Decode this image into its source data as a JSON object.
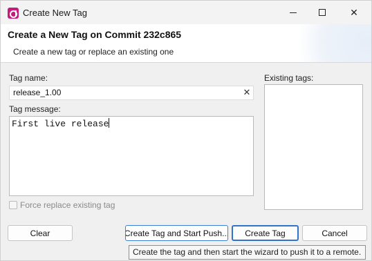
{
  "window": {
    "title": "Create New Tag",
    "app_icon": "app-logo-icon",
    "controls": {
      "minimize": "minimize-icon",
      "maximize": "maximize-icon",
      "close_glyph": "✕"
    }
  },
  "banner": {
    "title": "Create a New Tag on Commit 232c865",
    "subtitle": "Create a new tag or replace an existing one"
  },
  "form": {
    "tag_name_label": "Tag name:",
    "tag_name_value": "release_1.00",
    "clear_glyph": "✕",
    "tag_message_label": "Tag message:",
    "tag_message_value": "First live release",
    "existing_tags_label": "Existing tags:",
    "existing_tags": [],
    "force_replace_label": "Force replace existing tag",
    "force_replace_checked": false,
    "force_replace_enabled": false
  },
  "buttons": {
    "clear": "Clear",
    "create_and_push": "Create Tag and Start Push...",
    "create": "Create Tag",
    "cancel": "Cancel"
  },
  "tooltip": {
    "text": "Create the tag and then start the wizard to push it to a remote."
  },
  "colors": {
    "app_icon": "#c8197d",
    "default_button_border": "#2f73cc"
  }
}
